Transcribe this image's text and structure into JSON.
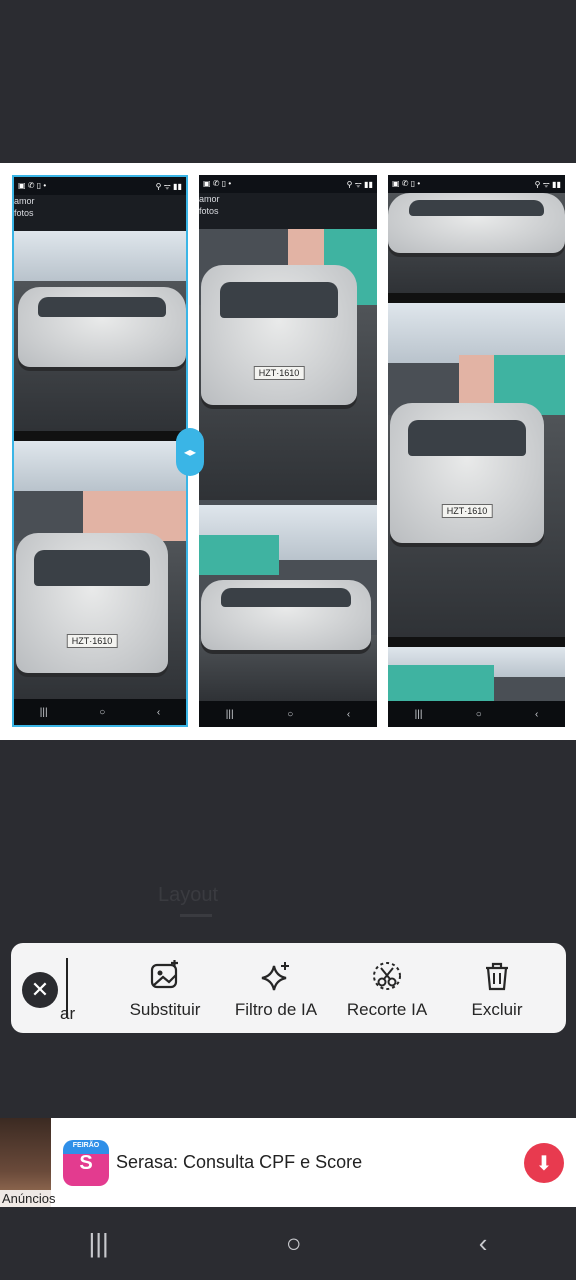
{
  "collage": {
    "panels": [
      {
        "status_left": "▣ ✆ ▯ •",
        "status_right": "⚲ ᯤ ▮▮",
        "title": "amor",
        "subtitle": "fotos"
      },
      {
        "status_left": "▣ ✆ ▯ •",
        "status_right": "⚲ ᯤ ▮▮",
        "title": "amor",
        "subtitle": "fotos"
      },
      {
        "status_left": "▣ ✆ ▯ •",
        "status_right": "⚲ ᯤ ▮▮",
        "title": "",
        "subtitle": ""
      }
    ],
    "plate_text": "HZT·1610",
    "nav_glyphs": [
      "|||",
      "○",
      "‹"
    ],
    "handle_glyph": "◂▸"
  },
  "tabs_ghost": {
    "active": "Layout"
  },
  "toolbar": {
    "close_glyph": "✕",
    "cut_label": "ar",
    "tools": [
      {
        "label": "Substituir",
        "icon": "replace-image-icon"
      },
      {
        "label": "Filtro de IA",
        "icon": "sparkle-icon"
      },
      {
        "label": "Recorte IA",
        "icon": "scissors-icon"
      },
      {
        "label": "Excluir",
        "icon": "trash-icon"
      }
    ]
  },
  "ad": {
    "tag": "Anúncios",
    "logo_text": "S",
    "logo_badge": "FEIRÃO",
    "title": "Serasa: Consulta CPF e Score",
    "download_glyph": "⬇"
  },
  "system_nav": {
    "recents": "|||",
    "home": "○",
    "back": "‹"
  },
  "colors": {
    "accent": "#3ab5e6",
    "ad_button": "#e83a4f",
    "toolbar_bg": "#f4f4f5",
    "app_bg": "#2b2c31"
  }
}
